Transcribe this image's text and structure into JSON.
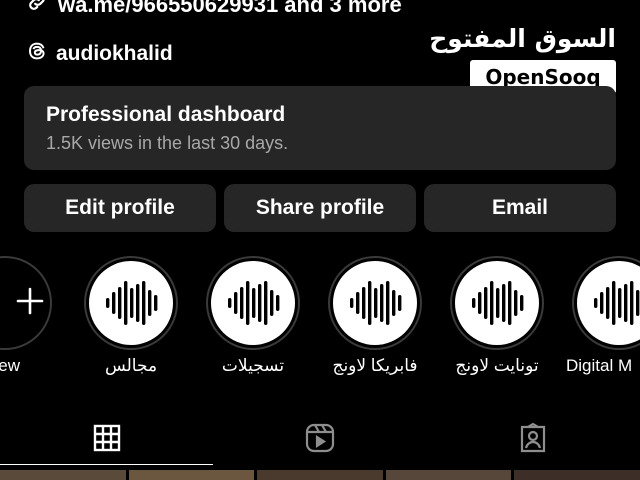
{
  "profile": {
    "link_text": "wa.me/966550629931 and 3 more",
    "threads_handle": "audiokhalid"
  },
  "watermark": {
    "arabic": "السوق المفتوح",
    "brand": "OpenSooq"
  },
  "dashboard": {
    "title": "Professional dashboard",
    "subtitle": "1.5K views in the last 30 days."
  },
  "buttons": {
    "edit": "Edit profile",
    "share": "Share profile",
    "email": "Email"
  },
  "highlights": {
    "new_label": "New",
    "items": [
      {
        "label": "مجالس"
      },
      {
        "label": "تسجيلات"
      },
      {
        "label": "فابريكا لاونج"
      },
      {
        "label": "تونايت لاونج"
      },
      {
        "label": "Digital M"
      }
    ]
  },
  "tabs": [
    "posts-grid-icon",
    "reels-icon",
    "tagged-icon"
  ],
  "colors": {
    "background": "#000000",
    "card": "#262626",
    "muted_text": "#a8a8a8",
    "text": "#ffffff"
  }
}
